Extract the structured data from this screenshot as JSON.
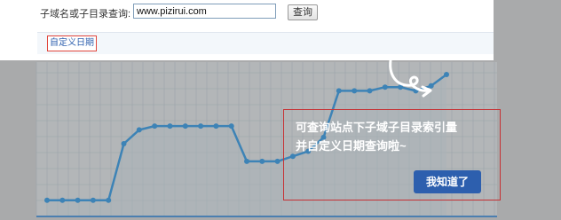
{
  "search": {
    "label": "子域名或子目录查询:",
    "value": "www.pizirui.com",
    "button_label": "查询"
  },
  "filter": {
    "custom_date_label": "自定义日期"
  },
  "chart_data": {
    "type": "line",
    "values": [
      10,
      10,
      10,
      10,
      10,
      55,
      66,
      69,
      69,
      69,
      69,
      69,
      69,
      41,
      41,
      41,
      45,
      49,
      60,
      97,
      97,
      97,
      100,
      100,
      97,
      101,
      110
    ],
    "ylim": [
      0,
      130
    ],
    "grid": true,
    "line_color": "#3d83b6"
  },
  "tooltip": {
    "line1": "可查询站点下子域子目录索引量",
    "line2": "并自定义日期查询啦~",
    "button_label": "我知道了"
  },
  "colors": {
    "accent": "#2d5fae",
    "highlight_border": "#c63235",
    "series": "#3d83b6"
  }
}
